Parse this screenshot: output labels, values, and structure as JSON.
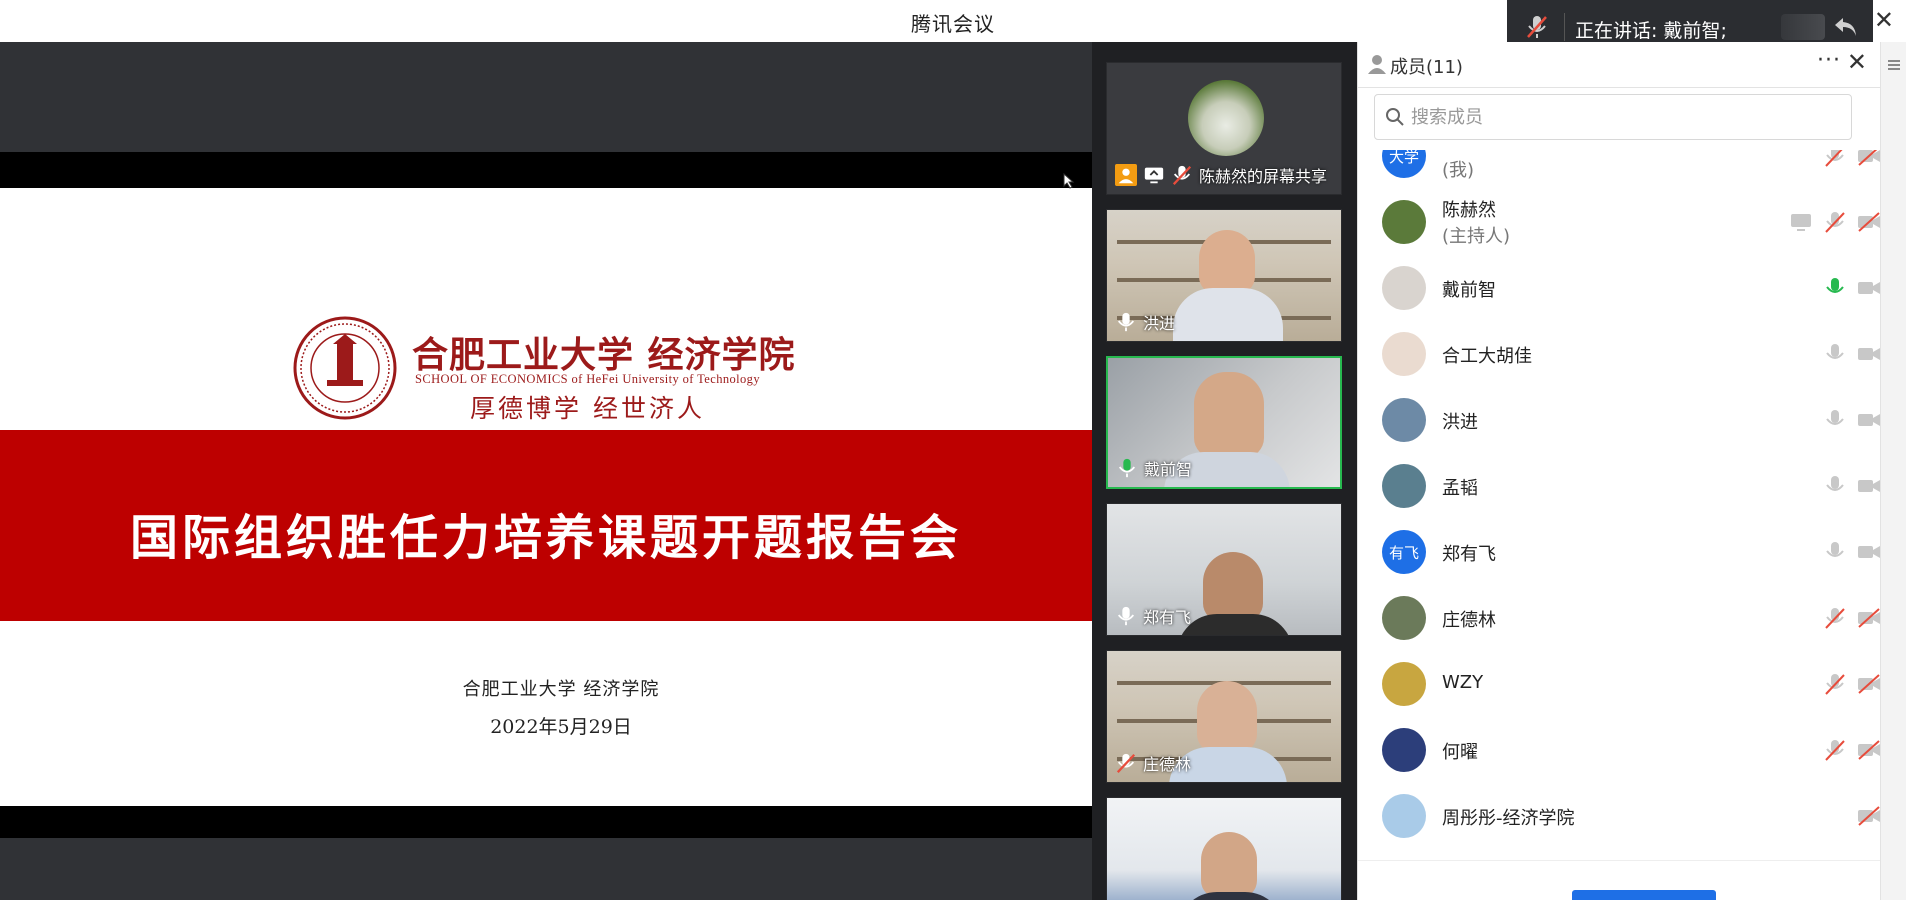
{
  "window": {
    "title": "腾讯会议",
    "close_label": "✕"
  },
  "speaking_toast": {
    "text": "正在讲话: 戴前智;"
  },
  "slide": {
    "school_cn": "合肥工业大学 经济学院",
    "school_en": "SCHOOL OF ECONOMICS of HeFei University of Technology",
    "motto": "厚德博学  经世济人",
    "headline": "国际组织胜任力培养课题开题报告会",
    "org": "合肥工业大学  经济学院",
    "date": "2022年5月29日"
  },
  "video_tiles": [
    {
      "name": "陈赫然的屏幕共享",
      "type": "screen-share",
      "mic": "muted"
    },
    {
      "name": "洪进",
      "type": "camera",
      "mic": "on"
    },
    {
      "name": "戴前智",
      "type": "camera",
      "mic": "speaking"
    },
    {
      "name": "郑有飞",
      "type": "camera",
      "mic": "on"
    },
    {
      "name": "庄德林",
      "type": "camera",
      "mic": "muted"
    },
    {
      "name": "",
      "type": "camera",
      "mic": "on"
    }
  ],
  "members_panel": {
    "title": "成员(11)",
    "more_label": "···",
    "close_label": "✕",
    "search_placeholder": "搜索成员",
    "members": [
      {
        "name": "",
        "sub": "(我)",
        "avatar_text": "大学",
        "avatar_color": "#1e6fe6",
        "mic": "muted",
        "cam": "off",
        "share": false
      },
      {
        "name": "陈赫然",
        "sub": "(主持人)",
        "avatar_text": "",
        "avatar_color": "#5b7a3a",
        "mic": "muted",
        "cam": "off",
        "share": true
      },
      {
        "name": "戴前智",
        "sub": "",
        "avatar_text": "",
        "avatar_color": "#d9d4cf",
        "mic": "speaking",
        "cam": "on",
        "share": false
      },
      {
        "name": "合工大胡佳",
        "sub": "",
        "avatar_text": "",
        "avatar_color": "#eadbd0",
        "mic": "on",
        "cam": "on",
        "share": false
      },
      {
        "name": "洪进",
        "sub": "",
        "avatar_text": "",
        "avatar_color": "#6d8aa6",
        "mic": "on",
        "cam": "on",
        "share": false
      },
      {
        "name": "孟韬",
        "sub": "",
        "avatar_text": "",
        "avatar_color": "#5a7f8f",
        "mic": "on",
        "cam": "on",
        "share": false
      },
      {
        "name": "郑有飞",
        "sub": "",
        "avatar_text": "有飞",
        "avatar_color": "#1e6fe6",
        "mic": "on",
        "cam": "on",
        "share": false
      },
      {
        "name": "庄德林",
        "sub": "",
        "avatar_text": "",
        "avatar_color": "#6b7a5a",
        "mic": "muted",
        "cam": "off",
        "share": false
      },
      {
        "name": "WZY",
        "sub": "",
        "avatar_text": "",
        "avatar_color": "#c8a640",
        "mic": "muted",
        "cam": "off",
        "share": false
      },
      {
        "name": "何曜",
        "sub": "",
        "avatar_text": "",
        "avatar_color": "#2c3e7a",
        "mic": "muted",
        "cam": "off",
        "share": false
      },
      {
        "name": "周彤彤-经济学院",
        "sub": "",
        "avatar_text": "",
        "avatar_color": "#a9cbe8",
        "mic": "none",
        "cam": "off",
        "share": false
      }
    ]
  },
  "colors": {
    "accent": "#1e6fe6",
    "speaking": "#27b94f",
    "muted": "#e74c3c",
    "slide_red": "#bd0000"
  }
}
